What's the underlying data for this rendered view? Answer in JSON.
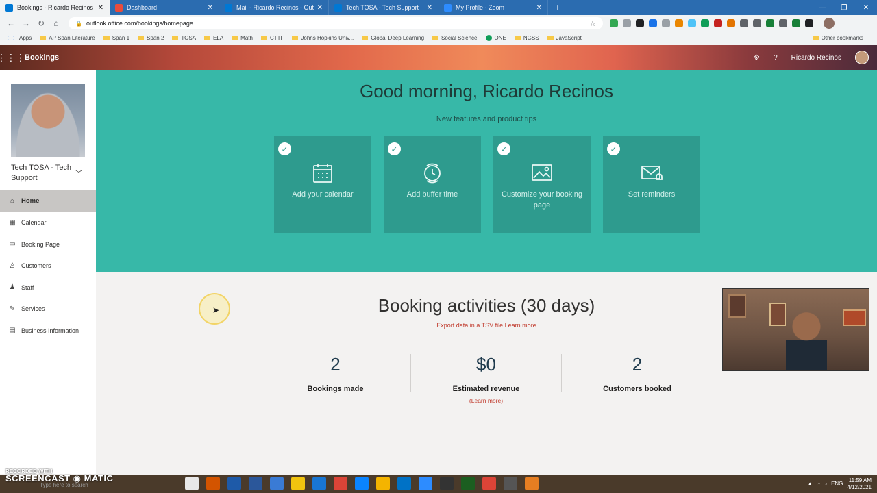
{
  "browser": {
    "tabs": [
      {
        "title": "Bookings - Ricardo Recinos - Ou",
        "color": "#0078d4",
        "active": true
      },
      {
        "title": "Dashboard",
        "color": "#e74c3c",
        "active": false
      },
      {
        "title": "Mail - Ricardo Recinos - Outlook",
        "color": "#0078d4",
        "active": false
      },
      {
        "title": "Tech TOSA - Tech Support",
        "color": "#0078d4",
        "active": false
      },
      {
        "title": "My Profile - Zoom",
        "color": "#2d8cff",
        "active": false
      }
    ],
    "new_tab": "+",
    "url": "outlook.office.com/bookings/homepage",
    "bookmarks": [
      {
        "label": "Apps",
        "type": "apps"
      },
      {
        "label": "AP Span Literature",
        "type": "folder"
      },
      {
        "label": "Span 1",
        "type": "folder"
      },
      {
        "label": "Span 2",
        "type": "folder"
      },
      {
        "label": "TOSA",
        "type": "folder"
      },
      {
        "label": "ELA",
        "type": "folder"
      },
      {
        "label": "Math",
        "type": "folder"
      },
      {
        "label": "CTTF",
        "type": "folder"
      },
      {
        "label": "Johns Hopkins Univ...",
        "type": "folder"
      },
      {
        "label": "Global Deep Learning",
        "type": "folder"
      },
      {
        "label": "Social Science",
        "type": "folder"
      },
      {
        "label": "ONE",
        "type": "site"
      },
      {
        "label": "NGSS",
        "type": "folder"
      },
      {
        "label": "JavaScript",
        "type": "folder"
      }
    ],
    "other_bookmarks": "Other bookmarks"
  },
  "app": {
    "name": "Bookings",
    "user": "Ricardo Recinos"
  },
  "sidebar": {
    "business_name": "Tech TOSA - Tech Support",
    "items": [
      {
        "label": "Home",
        "icon": "home-icon",
        "glyph": "⌂",
        "active": true
      },
      {
        "label": "Calendar",
        "icon": "calendar-icon",
        "glyph": "▦",
        "active": false
      },
      {
        "label": "Booking Page",
        "icon": "monitor-icon",
        "glyph": "▭",
        "active": false
      },
      {
        "label": "Customers",
        "icon": "people-icon",
        "glyph": "♙",
        "active": false
      },
      {
        "label": "Staff",
        "icon": "staff-icon",
        "glyph": "♟",
        "active": false
      },
      {
        "label": "Services",
        "icon": "services-icon",
        "glyph": "✎",
        "active": false
      },
      {
        "label": "Business Information",
        "icon": "info-icon",
        "glyph": "▤",
        "active": false
      }
    ]
  },
  "hero": {
    "greeting": "Good morning, Ricardo Recinos",
    "tips_label": "New features and product tips",
    "cards": [
      {
        "label": "Add your calendar",
        "icon": "calendar-icon",
        "glyph": "▦"
      },
      {
        "label": "Add buffer time",
        "icon": "clock-icon",
        "glyph": "◷"
      },
      {
        "label": "Customize your booking page",
        "icon": "image-icon",
        "glyph": "▨"
      },
      {
        "label": "Set reminders",
        "icon": "mail-bell-icon",
        "glyph": "✉"
      }
    ]
  },
  "activities": {
    "title": "Booking activities (30 days)",
    "export_text": "Export data in a TSV file Learn more",
    "stats": [
      {
        "value": "2",
        "label": "Bookings made",
        "more": ""
      },
      {
        "value": "$0",
        "label": "Estimated revenue",
        "more": "(Learn more)"
      },
      {
        "value": "2",
        "label": "Customers booked",
        "more": ""
      }
    ]
  },
  "taskbar": {
    "watermark_top": "RECORDED WITH",
    "watermark_brand": "SCREENCAST ◉ MATIC",
    "search_placeholder": "Type here to search",
    "lang": "ENG",
    "time": "11:59 AM",
    "date": "4/12/2021"
  }
}
